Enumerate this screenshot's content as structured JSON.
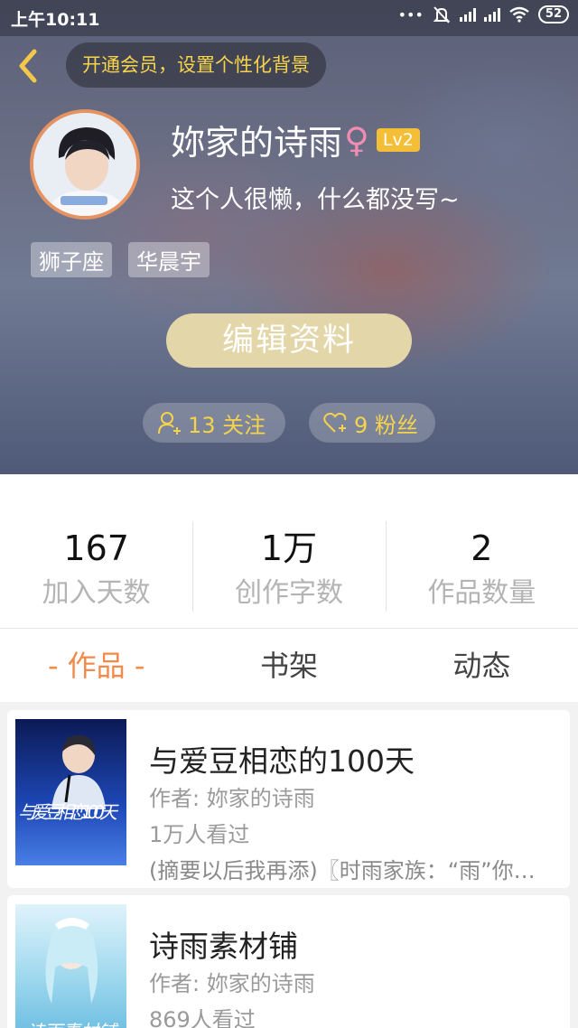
{
  "status_bar": {
    "time": "上午10:11",
    "dots": "•••",
    "battery": "52"
  },
  "header": {
    "vip_banner": "开通会员，设置个性化背景",
    "nickname": "妳家的诗雨",
    "gender_symbol": "♀",
    "level": "Lv2",
    "bio": "这个人很懒，什么都没写~",
    "tags": [
      "狮子座",
      "华晨宇"
    ],
    "edit_button": "编辑资料",
    "follow_count": "13 关注",
    "fans_count": "9 粉丝",
    "accent_color": "#f6d34b"
  },
  "stats": [
    {
      "value": "167",
      "label": "加入天数"
    },
    {
      "value": "1万",
      "label": "创作字数"
    },
    {
      "value": "2",
      "label": "作品数量"
    }
  ],
  "tabs": {
    "works": "- 作品 -",
    "bookshelf": "书架",
    "activity": "动态",
    "active_color": "#f28a4a"
  },
  "works": [
    {
      "title": "与爱豆相恋的100天",
      "author": "作者: 妳家的诗雨",
      "views": "1万人看过",
      "desc": "(摘要以后我再添)〖时雨家族：“雨”你共度〗",
      "cover_text": "与爱豆相恋100天"
    },
    {
      "title": "诗雨素材铺",
      "author": "作者: 妳家的诗雨",
      "views": "869人看过",
      "cover_text": "诗雨素材铺"
    }
  ]
}
